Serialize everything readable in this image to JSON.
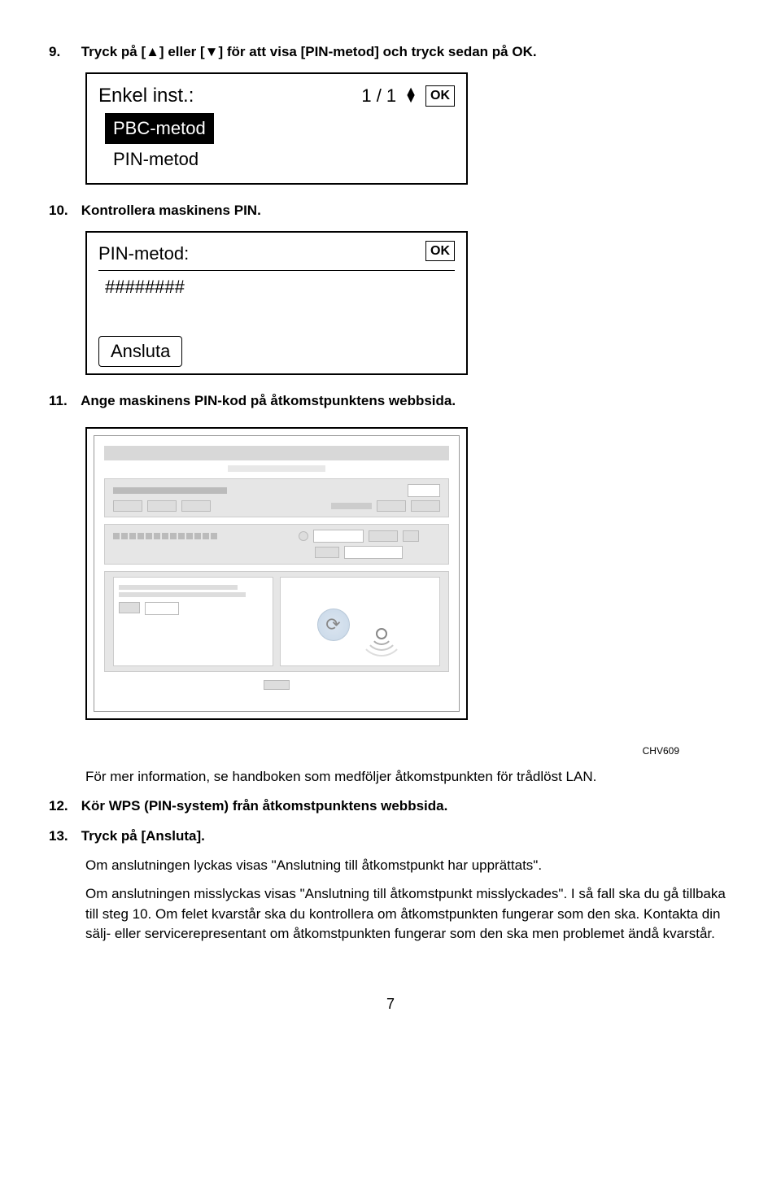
{
  "step9": {
    "num": "9.",
    "text": "Tryck på [▲] eller [▼] för att visa [PIN-metod] och tryck sedan på OK."
  },
  "display1": {
    "title": "Enkel inst.:",
    "pager": "1 / 1",
    "ok": "OK",
    "selected": "PBC-metod",
    "unselected": "PIN-metod"
  },
  "step10": {
    "num": "10.",
    "text": "Kontrollera maskinens PIN."
  },
  "display2": {
    "title": "PIN-metod:",
    "ok": "OK",
    "hashes": "########",
    "button": "Ansluta"
  },
  "step11": {
    "num": "11.",
    "text": "Ange maskinens PIN-kod på åtkomstpunktens webbsida."
  },
  "chv": "CHV609",
  "bodytext1": "För mer information, se handboken som medföljer åtkomstpunkten för trådlöst LAN.",
  "step12": {
    "num": "12.",
    "text": "Kör WPS (PIN-system) från åtkomstpunktens webbsida."
  },
  "step13": {
    "num": "13.",
    "text": "Tryck på [Ansluta]."
  },
  "bodytext2": "Om anslutningen lyckas visas \"Anslutning till åtkomstpunkt har upprättats\".",
  "bodytext3": "Om anslutningen misslyckas visas \"Anslutning till åtkomstpunkt misslyckades\". I så fall ska du gå tillbaka till steg 10. Om felet kvarstår ska du kontrollera om åtkomstpunkten fungerar som den ska. Kontakta din sälj- eller servicerepresentant om åtkomstpunkten fungerar som den ska men problemet ändå kvarstår.",
  "pagenum": "7"
}
